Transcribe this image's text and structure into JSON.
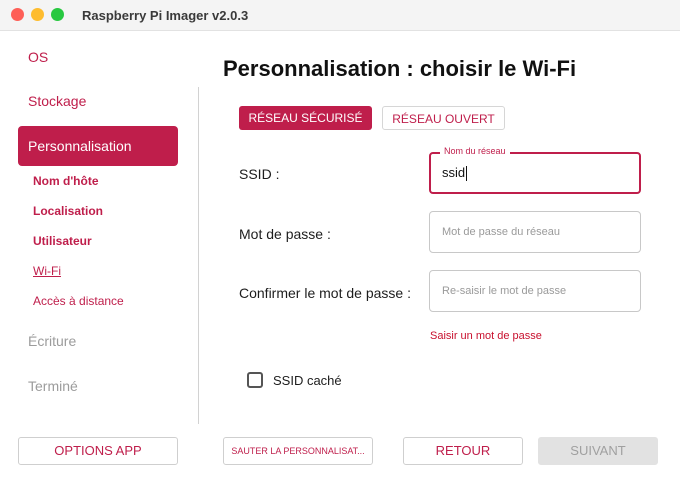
{
  "window": {
    "title": "Raspberry Pi Imager v2.0.3"
  },
  "sidebar": {
    "items": [
      {
        "label": "OS"
      },
      {
        "label": "Stockage"
      },
      {
        "label": "Personnalisation"
      },
      {
        "label": "Écriture"
      },
      {
        "label": "Terminé"
      }
    ],
    "sub_items": [
      {
        "label": "Nom d'hôte"
      },
      {
        "label": "Localisation"
      },
      {
        "label": "Utilisateur"
      },
      {
        "label": "Wi-Fi"
      },
      {
        "label": "Accès à distance"
      }
    ]
  },
  "main": {
    "title": "Personnalisation : choisir le Wi-Fi",
    "tabs": [
      {
        "label": "RÉSEAU SÉCURISÉ",
        "selected": true
      },
      {
        "label": "RÉSEAU OUVERT",
        "selected": false
      }
    ],
    "ssid": {
      "label": "SSID :",
      "float_label": "Nom du réseau",
      "value": "ssid"
    },
    "password": {
      "label": "Mot de passe :",
      "placeholder": "Mot de passe du réseau",
      "value": ""
    },
    "confirm": {
      "label": "Confirmer le mot de passe :",
      "placeholder": "Re-saisir le mot de passe",
      "value": ""
    },
    "error": "Saisir un mot de passe",
    "hidden_ssid": {
      "label": "SSID caché",
      "checked": false
    }
  },
  "footer": {
    "options": "OPTIONS APP",
    "skip": "SAUTER LA PERSONNALISAT...",
    "back": "RETOUR",
    "next": "SUIVANT"
  },
  "colors": {
    "accent": "#bf1e4b",
    "error": "#c8102e",
    "disabled_bg": "#e2e2e2"
  }
}
